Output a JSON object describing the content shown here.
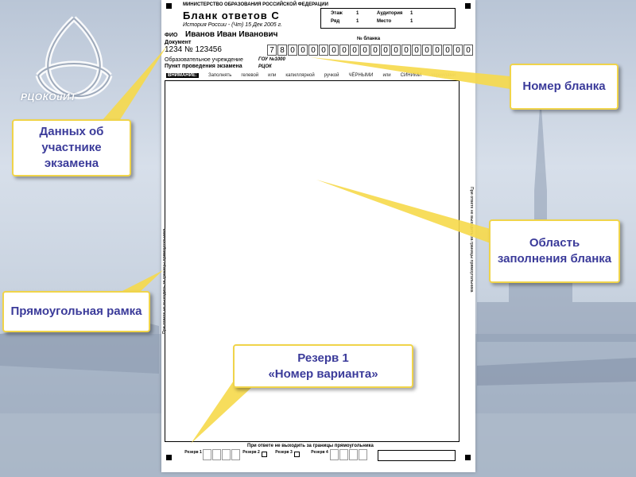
{
  "logo": {
    "text": "РЦОКОиИТ"
  },
  "form": {
    "ministry": "МИНИСТЕРСТВО ОБРАЗОВАНИЯ РОССИЙСКОЙ ФЕДЕРАЦИИ",
    "title": "Бланк ответов С",
    "subject": "История России - (Чт) 15 Дек 2005 г.",
    "fio_label": "ФИО",
    "fio_value": "Иванов Иван Иванович",
    "doc_label": "Документ",
    "doc_value": "1234 № 123456",
    "edu_label": "Образовательное учреждение",
    "edu_value": "ГОУ №1000",
    "exam_point_label": "Пункт проведения экзамена",
    "exam_point_value": "РЦОК",
    "number_label": "№ бланка",
    "info": {
      "floor_label": "Этаж",
      "floor_value": "1",
      "room_label": "Аудитория",
      "room_value": "1",
      "row_label": "Ряд",
      "row_value": "1",
      "seat_label": "Место",
      "seat_value": "1"
    },
    "digits": [
      "7",
      "8",
      "0",
      "0",
      "0",
      "0",
      "0",
      "0",
      "0",
      "0",
      "0",
      "0",
      "0",
      "0",
      "0",
      "0",
      "0",
      "0",
      "0",
      "0"
    ],
    "warning": {
      "first": "ВНИМАНИЕ:",
      "words": [
        "Заполнять",
        "гелевой",
        "или",
        "капиллярной",
        "ручкой",
        "ЧЁРНЫМИ",
        "или",
        "СИНИМИ"
      ],
      "faded": "чернилами"
    },
    "border_warning": "При ответе не выходить за границы прямоугольника",
    "reserves": {
      "r1": "Резерв 1",
      "r2": "Резерв 2",
      "r3": "Резерв 3",
      "r4": "Резерв 4"
    }
  },
  "callouts": {
    "participant_data": "Данных об участнике экзамена",
    "rect_frame": "Прямоугольная рамка",
    "blank_number": "Номер бланка",
    "fill_area": "Область заполнения бланка",
    "reserve_line1": "Резерв 1",
    "reserve_line2": "«Номер варианта»"
  },
  "colors": {
    "callout_border": "#f0d44a",
    "callout_text": "#3b3b9a",
    "pointer": "#f6d94a"
  }
}
